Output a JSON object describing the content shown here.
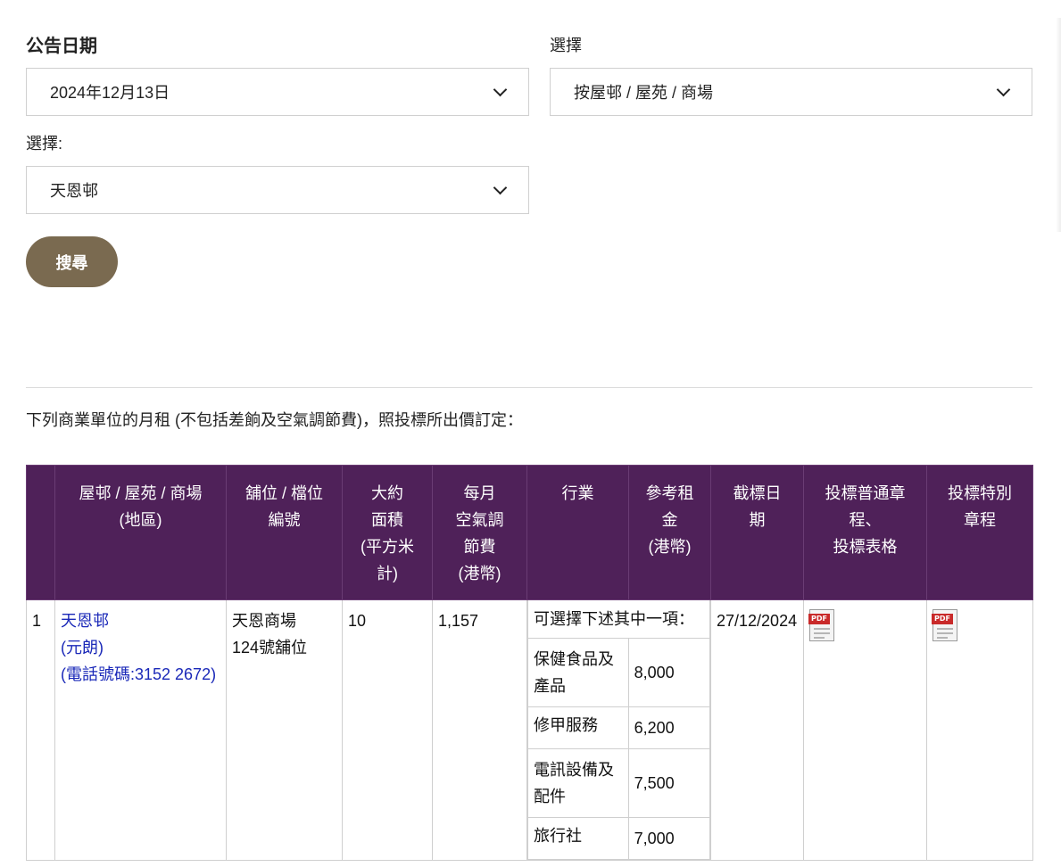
{
  "filters": {
    "date_label": "公告日期",
    "date_value": "2024年12月13日",
    "type_label": "選擇",
    "type_value": "按屋邨 / 屋苑 / 商場",
    "estate_label": "選擇:",
    "estate_value": "天恩邨",
    "search_button": "搜尋"
  },
  "note": "下列商業單位的月租 (不包括差餉及空氣調節費)，照投標所出價訂定：",
  "table": {
    "headers": {
      "estate": [
        "屋邨 / 屋苑 / 商場",
        "(地區)"
      ],
      "shop": [
        "舖位 / 檔位",
        "編號"
      ],
      "area": [
        "大約",
        "面積",
        "(平方米",
        "計)"
      ],
      "ac_fee": [
        "每月",
        "空氣調",
        "節費",
        "(港幣)"
      ],
      "trade": [
        "行業"
      ],
      "ref_rent": [
        "參考租",
        "金",
        "(港幣)"
      ],
      "deadline": [
        "截標日",
        "期"
      ],
      "general_terms": [
        "投標普通章",
        "程、",
        "投標表格"
      ],
      "special_terms": [
        "投標特別",
        "章程"
      ]
    },
    "rows": [
      {
        "index": "1",
        "estate_name": "天恩邨",
        "district": "(元朗)",
        "phone": "(電話號碼:3152 2672)",
        "shop_line1": "天恩商場",
        "shop_line2": "124號舖位",
        "area": "10",
        "ac_fee": "1,157",
        "trade_intro": "可選擇下述其中一項：",
        "trades": [
          {
            "name_line1": "保健食品及",
            "name_line2": "產品",
            "rent": "8,000"
          },
          {
            "name_line1": "修甲服務",
            "name_line2": "",
            "rent": "6,200"
          },
          {
            "name_line1": "電訊設備及",
            "name_line2": "配件",
            "rent": "7,500"
          },
          {
            "name_line1": "旅行社",
            "name_line2": "",
            "rent": "7,000"
          }
        ],
        "deadline": "27/12/2024",
        "pdf_tag": "PDF"
      }
    ]
  },
  "icons": {
    "chevron": "chevron-down-icon",
    "pdf": "pdf-icon"
  },
  "colors": {
    "header_bg": "#4f2159",
    "button_bg": "#7a6a50",
    "link": "#1a28b8"
  }
}
